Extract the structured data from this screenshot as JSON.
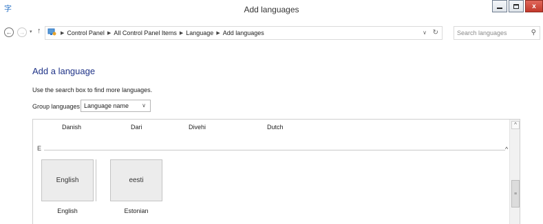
{
  "window": {
    "title": "Add languages",
    "close_label": "x"
  },
  "nav": {
    "back_icon": "←",
    "forward_icon": "→",
    "recent_icon": "▾",
    "up_icon": "↑",
    "breadcrumbs": [
      "Control Panel",
      "All Control Panel Items",
      "Language",
      "Add languages"
    ],
    "dropdown_icon": "∨",
    "refresh_icon": "↻"
  },
  "search": {
    "placeholder": "Search languages"
  },
  "content": {
    "heading": "Add a language",
    "instructions": "Use the search box to find more languages.",
    "group_by_label": "Group languages by:",
    "group_by_value": "Language name"
  },
  "language_list": {
    "previous_row": [
      "Danish",
      "Dari",
      "Divehi",
      "Dutch"
    ],
    "group": {
      "letter": "E",
      "collapse_icon": "^",
      "tiles": [
        {
          "display": "English",
          "name": "English"
        },
        {
          "display": "eesti",
          "name": "Estonian"
        }
      ]
    }
  },
  "scrollbar": {
    "up_icon": "^",
    "thumb_grip": "≡"
  }
}
